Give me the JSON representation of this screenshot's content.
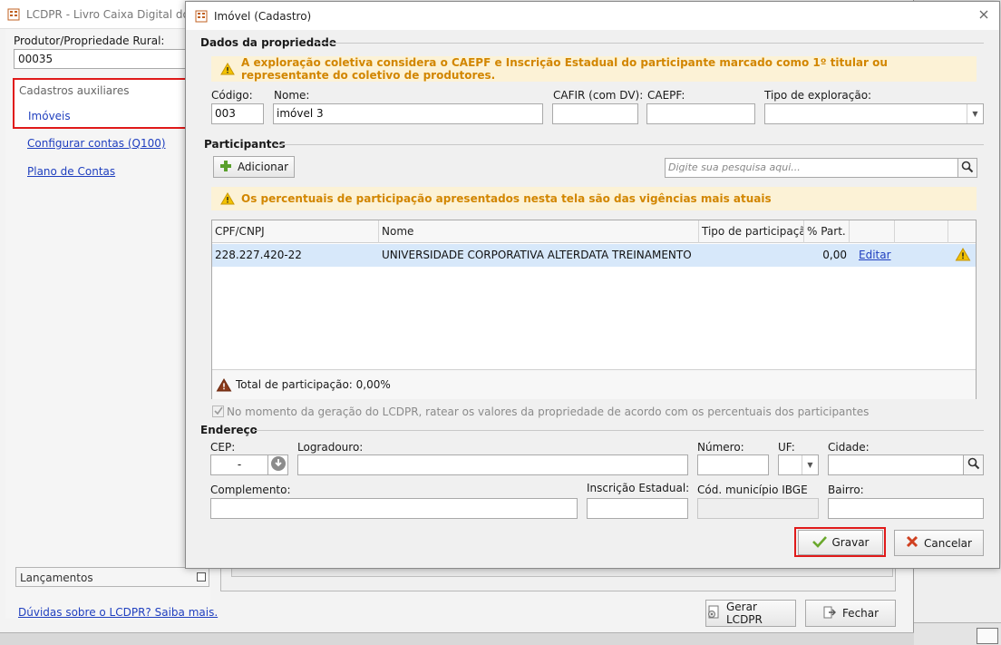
{
  "main_window": {
    "title": "LCDPR - Livro Caixa Digital do Pr",
    "producer_label": "Produtor/Propriedade Rural:",
    "producer_value": "00035",
    "aux_title": "Cadastros auxiliares",
    "aux_imoveis": "Imóveis",
    "link_configurar": "Configurar contas (Q100)",
    "link_plano": "Plano de Contas",
    "lancamentos": "Lançamentos",
    "help_link": "Dúvidas sobre o LCDPR? Saiba mais.",
    "btn_gerar": "Gerar LCDPR",
    "btn_fechar": "Fechar"
  },
  "dialog": {
    "title": "Imóvel (Cadastro)",
    "section_dados": "Dados da propriedade",
    "warning_coletiva": "A exploração coletiva considera o CAEPF e Inscrição Estadual do participante marcado como 1º titular ou representante do coletivo de produtores.",
    "codigo_label": "Código:",
    "codigo_value": "003",
    "nome_label": "Nome:",
    "nome_value": "imóvel 3",
    "cafir_label": "CAFIR (com DV):",
    "cafir_value": "",
    "caepf_label": "CAEPF:",
    "caepf_value": "",
    "tipo_exploracao_label": "Tipo de exploração:",
    "tipo_exploracao_value": "",
    "section_participantes": "Participantes",
    "btn_adicionar": "Adicionar",
    "search_placeholder": "Digite sua pesquisa aqui...",
    "warning_percentuais": "Os percentuais de participação apresentados nesta tela são das vigências mais atuais",
    "grid_headers": [
      "CPF/CNPJ",
      "Nome",
      "Tipo de participação",
      "% Part.",
      "",
      ""
    ],
    "grid_rows": [
      {
        "cpf": "228.227.420-22",
        "nome": "UNIVERSIDADE CORPORATIVA ALTERDATA TREINAMENTO",
        "tipo": "",
        "perc": "0,00",
        "action": "Editar"
      }
    ],
    "total_participacao": "Total de participação: 0,00%",
    "ratear_label": "No momento da geração do LCDPR, ratear os valores da propriedade de acordo com os percentuais dos participantes",
    "section_endereco": "Endereço",
    "cep_label": "CEP:",
    "cep_value": "-",
    "logradouro_label": "Logradouro:",
    "numero_label": "Número:",
    "uf_label": "UF:",
    "cidade_label": "Cidade:",
    "complemento_label": "Complemento:",
    "inscricao_label": "Inscrição Estadual:",
    "ibge_label": "Cód. município IBGE",
    "bairro_label": "Bairro:",
    "btn_gravar": "Gravar",
    "btn_cancelar": "Cancelar"
  },
  "colors": {
    "highlight_red": "#e01a1a",
    "link_blue": "#1f3fbf",
    "warning_bg": "#fcf2d6",
    "warning_text": "#d28600",
    "selected_row": "#d7e8fa"
  }
}
